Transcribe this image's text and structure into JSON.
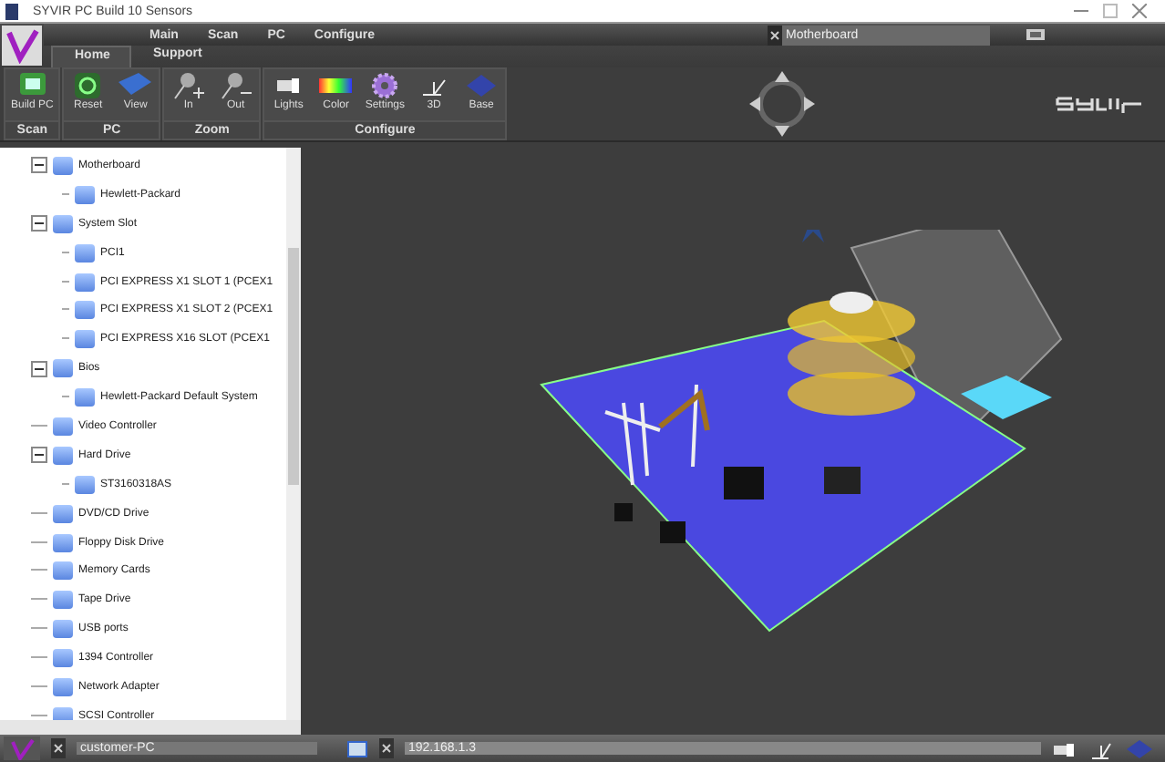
{
  "window": {
    "title": "SYVIR PC Build 10 Sensors"
  },
  "menu": [
    "Main",
    "Scan",
    "PC",
    "Configure"
  ],
  "document_tab": {
    "label": "Motherboard"
  },
  "tabs": [
    {
      "label": "Home",
      "selected": true
    },
    {
      "label": "Support",
      "selected": false
    }
  ],
  "ribbon_groups": [
    {
      "label": "Scan",
      "buttons": [
        {
          "label": "Build PC",
          "kind": "build"
        }
      ]
    },
    {
      "label": "PC",
      "buttons": [
        {
          "label": "Reset",
          "kind": "reset"
        },
        {
          "label": "View",
          "kind": "view"
        }
      ]
    },
    {
      "label": "Zoom",
      "buttons": [
        {
          "label": "In",
          "kind": "zoomin"
        },
        {
          "label": "Out",
          "kind": "zoomout"
        }
      ]
    },
    {
      "label": "Configure",
      "buttons": [
        {
          "label": "Lights",
          "kind": "lights"
        },
        {
          "label": "Color",
          "kind": "color"
        },
        {
          "label": "Settings",
          "kind": "settings"
        },
        {
          "label": "3D",
          "kind": "axes"
        },
        {
          "label": "Base",
          "kind": "base"
        }
      ]
    }
  ],
  "tree": [
    {
      "label": "Motherboard",
      "expanded": true,
      "children": [
        {
          "label": "Hewlett-Packard"
        }
      ]
    },
    {
      "label": "System Slot",
      "expanded": true,
      "children": [
        {
          "label": "PCI1"
        },
        {
          "label": "PCI EXPRESS X1 SLOT 1 (PCEX1"
        },
        {
          "label": "PCI EXPRESS X1 SLOT 2 (PCEX1"
        },
        {
          "label": "PCI EXPRESS X16 SLOT (PCEX1"
        }
      ]
    },
    {
      "label": "Bios",
      "expanded": true,
      "children": [
        {
          "label": "Hewlett-Packard Default System"
        }
      ]
    },
    {
      "label": "Video Controller"
    },
    {
      "label": "Hard Drive",
      "expanded": true,
      "children": [
        {
          "label": "ST3160318AS"
        }
      ]
    },
    {
      "label": "DVD/CD Drive"
    },
    {
      "label": "Floppy Disk Drive"
    },
    {
      "label": "Memory Cards"
    },
    {
      "label": "Tape Drive"
    },
    {
      "label": "USB ports"
    },
    {
      "label": "1394 Controller"
    },
    {
      "label": "Network Adapter"
    },
    {
      "label": "SCSI Controller"
    }
  ],
  "status_bar": {
    "computer": "customer-PC",
    "address": "192.168.1.3"
  }
}
